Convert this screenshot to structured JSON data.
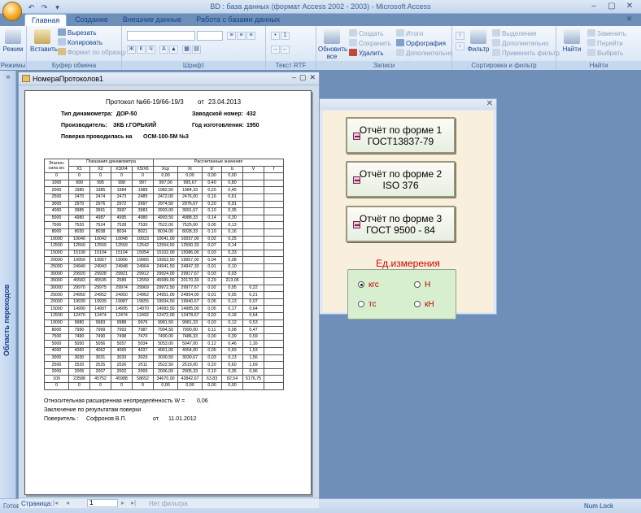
{
  "app": {
    "title": "BD : база данных (формат Access 2002 - 2003) - Microsoft Access",
    "window_controls": [
      "–",
      "▢",
      "✕"
    ],
    "qat": [
      "↶",
      "↷",
      "▾"
    ],
    "ribbon_close": "✕"
  },
  "ribbon": {
    "tabs": [
      {
        "label": "Главная",
        "active": true
      },
      {
        "label": "Создание",
        "active": false
      },
      {
        "label": "Внешние данные",
        "active": false
      },
      {
        "label": "Работа с базами данных",
        "active": false
      }
    ],
    "groups": {
      "modes": {
        "label": "Режимы",
        "view": "Режим"
      },
      "clipboard": {
        "label": "Буфер обмена",
        "paste": "Вставить",
        "cut": "Вырезать",
        "copy": "Копировать",
        "format_painter": "Формат по образцу"
      },
      "font": {
        "label": "Шрифт"
      },
      "rtf": {
        "label": "Текст RTF"
      },
      "records": {
        "label": "Записи",
        "refresh": "Обновить все",
        "create": "Создать",
        "save": "Сохранить",
        "delete": "Удалить",
        "totals": "Итоги",
        "spelling": "Орфография",
        "more": "Дополнительно"
      },
      "sort": {
        "label": "Сортировка и фильтр",
        "filter": "Фильтр",
        "selection": "Выделение",
        "advanced": "Дополнительно",
        "apply": "Применить фильтр"
      },
      "find": {
        "label": "Найти",
        "find": "Найти",
        "replace": "Заменить",
        "goto": "Перейти",
        "select": "Выбрать"
      }
    }
  },
  "nav_pane": {
    "label": "Область переходов",
    "expand": "»"
  },
  "statusbar": {
    "left": "Готово",
    "right": "Num Lock"
  },
  "form": {
    "close": "✕",
    "buttons": [
      {
        "line1": "Отчёт по форме 1",
        "line2": "ГОСТ13837-79"
      },
      {
        "line1": "Отчёт по форме 2",
        "line2": "ISO 376"
      },
      {
        "line1": "Отчёт по форме 3",
        "line2": "ГОСТ 9500 - 84"
      }
    ],
    "unit_label": "Ед.измерения",
    "units": [
      {
        "label": "кгс",
        "selected": true
      },
      {
        "label": "Н",
        "selected": false
      },
      {
        "label": "тс",
        "selected": false
      },
      {
        "label": "кН",
        "selected": false
      }
    ]
  },
  "report": {
    "window_title": "НомераПротоколов1",
    "window_controls": [
      "–",
      "▢",
      "✕"
    ],
    "header": {
      "protocol_label": "Протокол №66-19/66-19/3",
      "date_prefix": "от",
      "date": "23.04.2013",
      "dyn_type_label": "Тип динамометра:",
      "dyn_type": "ДОР-50",
      "serial_label": "Заводской номер:",
      "serial": "432",
      "maker_label": "Производитель:",
      "maker": "ЗКБ г.ГОРЬКИЙ",
      "year_label": "Год изготовления:",
      "year": "1950",
      "verify_label": "Поверка проводилась на",
      "verify": "ОСМ-100-5М №3"
    },
    "table": {
      "group_headers": {
        "etalon": "Эталон. сила кгс",
        "readings": "Показания динамометра",
        "calc": "Рассчитанные значения"
      },
      "columns": [
        "X1",
        "X2",
        "X3/X4",
        "X5/X6",
        "Xср",
        "Xr",
        "b'",
        "b",
        "V",
        "f"
      ],
      "rows": [
        [
          "0",
          "0",
          "0",
          "0",
          "0",
          "0,00",
          "0,00",
          "0,00",
          "0,00",
          "",
          ""
        ],
        [
          "1000",
          "999",
          "995",
          "998",
          "997",
          "997,00",
          "995,67",
          "0,40",
          "0,80",
          "",
          ""
        ],
        [
          "2000",
          "1980",
          "1985",
          "1984",
          "1989",
          "1982,50",
          "1984,33",
          "0,25",
          "0,45",
          "",
          ""
        ],
        [
          "2500",
          "2470",
          "2474",
          "2473",
          "2485",
          "2472,00",
          "2476,00",
          "0,16",
          "0,61",
          "",
          ""
        ],
        [
          "3000",
          "2970",
          "2976",
          "2972",
          "2997",
          "2974,50",
          "2976,67",
          "0,20",
          "0,91",
          "",
          ""
        ],
        [
          "4000",
          "3985",
          "3991",
          "3997",
          "3983",
          "3993,00",
          "3991,67",
          "0,10",
          "0,35",
          "",
          ""
        ],
        [
          "5000",
          "4980",
          "4987",
          "4995",
          "4980",
          "4993,50",
          "4988,33",
          "0,14",
          "0,30",
          "",
          ""
        ],
        [
          "7500",
          "7520",
          "7524",
          "7528",
          "7530",
          "7522,00",
          "7525,00",
          "0,05",
          "0,13",
          "",
          ""
        ],
        [
          "8000",
          "8030",
          "8038",
          "8034",
          "8021",
          "8034,00",
          "8028,33",
          "0,10",
          "0,16",
          "",
          ""
        ],
        [
          "10000",
          "10040",
          "10042",
          "10048",
          "10023",
          "10041,00",
          "10037,00",
          "0,02",
          "0,25",
          "",
          ""
        ],
        [
          "12500",
          "12550",
          "12559",
          "12559",
          "12542",
          "12554,50",
          "12550,33",
          "0,07",
          "0,14",
          "",
          ""
        ],
        [
          "15000",
          "15100",
          "15104",
          "15104",
          "15054",
          "15102,00",
          "15086,00",
          "0,03",
          "0,33",
          "",
          ""
        ],
        [
          "20000",
          "19950",
          "19957",
          "19966",
          "19965",
          "19953,50",
          "19957,00",
          "0,04",
          "0,08",
          "",
          ""
        ],
        [
          "25000",
          "24940",
          "24943",
          "24948",
          "24964",
          "24941,50",
          "24947,33",
          "0,01",
          "0,10",
          "",
          ""
        ],
        [
          "30000",
          "29920",
          "29928",
          "29921",
          "29912",
          "29924,00",
          "29917,67",
          "0,03",
          "0,03",
          "",
          ""
        ],
        [
          "35000",
          "45583",
          "45595",
          "2589",
          "12559",
          "45589,00",
          "20170,33",
          "0,29",
          "213,06",
          "",
          ""
        ],
        [
          "30000",
          "29970",
          "29975",
          "29974",
          "29969",
          "29972,50",
          "29977,67",
          "0,02",
          "0,05",
          "0,22",
          ""
        ],
        [
          "25000",
          "24950",
          "24952",
          "24950",
          "24962",
          "24951,00",
          "24954,00",
          "0,01",
          "0,05",
          "0,21",
          ""
        ],
        [
          "20000",
          "19930",
          "19939",
          "19987",
          "19655",
          "19934,50",
          "19940,67",
          "0,05",
          "0,13",
          "0,07",
          ""
        ],
        [
          "15000",
          "14990",
          "14997",
          "14995",
          "14970",
          "14993,50",
          "14985,00",
          "0,05",
          "0,17",
          "0,64",
          ""
        ],
        [
          "12500",
          "12470",
          "12474",
          "12474",
          "12492",
          "12472,00",
          "12478,67",
          "0,03",
          "0,18",
          "0,64",
          ""
        ],
        [
          "10000",
          "9980",
          "9983",
          "9988",
          "9976",
          "9981,50",
          "9981,33",
          "0,03",
          "0,12",
          "0,53",
          ""
        ],
        [
          "8000",
          "7990",
          "7999",
          "7993",
          "7987",
          "7994,50",
          "7990,00",
          "0,11",
          "0,08",
          "0,47",
          ""
        ],
        [
          "7500",
          "7490",
          "7490",
          "7498",
          "7470",
          "7490,00",
          "7486,33",
          "0,00",
          "0,39",
          "0,59",
          ""
        ],
        [
          "5000",
          "5050",
          "5056",
          "5057",
          "5034",
          "5053,00",
          "5047,00",
          "0,12",
          "0,46",
          "1,16",
          ""
        ],
        [
          "4000",
          "4060",
          "4062",
          "4065",
          "4037",
          "4061,00",
          "4054,00",
          "0,05",
          "0,69",
          "1,53",
          ""
        ],
        [
          "3000",
          "3030",
          "3031",
          "3033",
          "3029",
          "3030,50",
          "3030,67",
          "0,03",
          "0,13",
          "1,56",
          ""
        ],
        [
          "2500",
          "2520",
          "2525",
          "2526",
          "2511",
          "2522,50",
          "2519,00",
          "0,20",
          "0,60",
          "1,69",
          ""
        ],
        [
          "2000",
          "2005",
          "2007",
          "2002",
          "2009",
          "2006,00",
          "2005,33",
          "0,10",
          "0,35",
          "0,96",
          ""
        ],
        [
          "100",
          "23588",
          "45752",
          "45988",
          "58652",
          "34670,00",
          "42842,67",
          "63,83",
          "82,54",
          "5176,75",
          ""
        ],
        [
          "0",
          "0",
          "0",
          "0",
          "0",
          "0,00",
          "0,00",
          "0,00",
          "0,00",
          "",
          ""
        ]
      ]
    },
    "footer": {
      "uncertainty": "Относительная расширенная неопределённость W =",
      "uncertainty_value": "0,06",
      "conclusion": "Заключение по результатам поверки",
      "verifier_label": "Поверитель :",
      "verifier": "Софронов В.П.",
      "verify_date_prefix": "от",
      "verify_date": "11.01.2012"
    },
    "nav": {
      "page_label": "Страница:",
      "page": "1",
      "filter": "Нет фильтра"
    }
  }
}
